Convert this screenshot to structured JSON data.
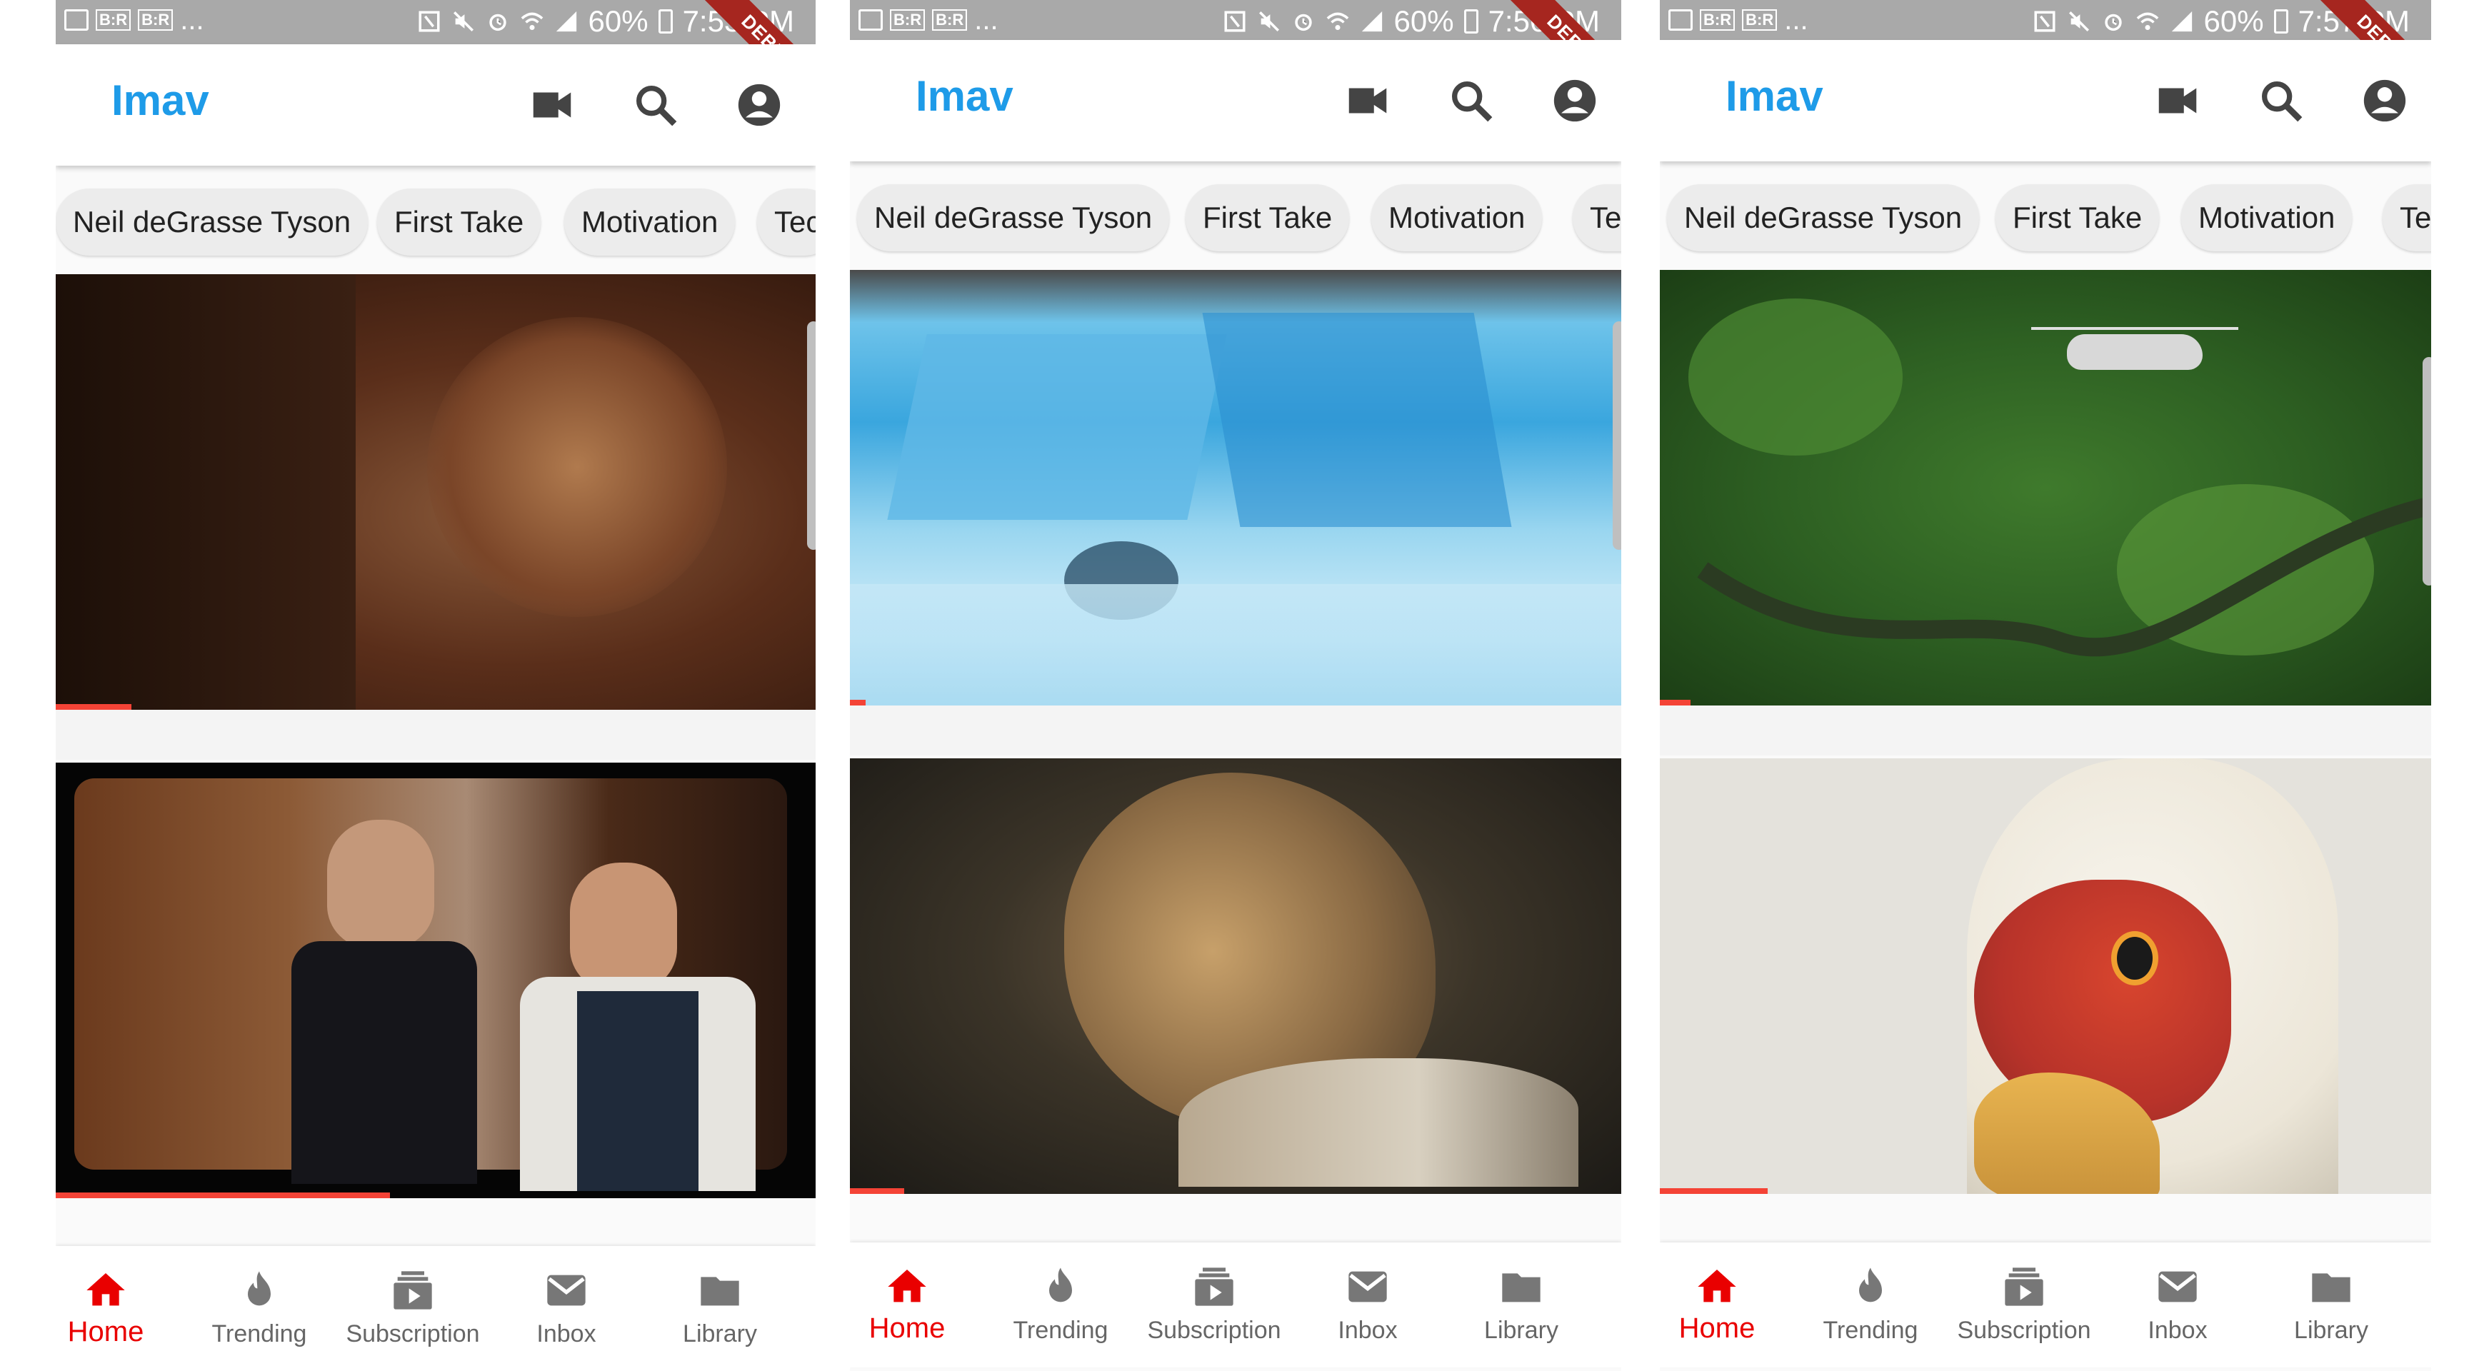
{
  "colors": {
    "status_bar": "#a9a9a9",
    "brand_blue": "#1e9be8",
    "active_red": "#e90000",
    "progress_red": "#f44336",
    "debug_ribbon": "#a6261f"
  },
  "screens": [
    {
      "status": {
        "battery": "60%",
        "time": "7:53 PM",
        "chip1": "B:R",
        "chip2": "B:R",
        "more": "..."
      },
      "debug_label": "DEBUG",
      "app_title": "Imav",
      "chips": [
        "Neil deGrasse Tyson",
        "First Take",
        "Motivation",
        "Tec"
      ],
      "videos": [
        {
          "scene": "close-up face, warm brown tones",
          "progress": 0.1
        },
        {
          "scene": "two men in suits, wedding",
          "progress": 0.44
        }
      ],
      "nav": [
        "Home",
        "Trending",
        "Subscription",
        "Inbox",
        "Library"
      ],
      "active_nav": "Home"
    },
    {
      "status": {
        "battery": "60%",
        "time": "7:56 PM",
        "chip1": "B:R",
        "chip2": "B:R",
        "more": "..."
      },
      "debug_label": "DEBUG",
      "app_title": "Imav",
      "chips": [
        "Neil deGrasse Tyson",
        "First Take",
        "Motivation",
        "Tec"
      ],
      "videos": [
        {
          "scene": "blue glacier ice",
          "progress": 0.02
        },
        {
          "scene": "leopard lying down",
          "progress": 0.07
        }
      ],
      "nav": [
        "Home",
        "Trending",
        "Subscription",
        "Inbox",
        "Library"
      ],
      "active_nav": "Home"
    },
    {
      "status": {
        "battery": "60%",
        "time": "7:57 PM",
        "chip1": "B:R",
        "chip2": "B:R",
        "more": "..."
      },
      "debug_label": "DEBUG",
      "app_title": "Imav",
      "chips": [
        "Neil deGrasse Tyson",
        "First Take",
        "Motivation",
        "Tec"
      ],
      "videos": [
        {
          "scene": "helicopter over rainforest",
          "progress": 0.04
        },
        {
          "scene": "vulture head close-up",
          "progress": 0.14
        }
      ],
      "nav": [
        "Home",
        "Trending",
        "Subscription",
        "Inbox",
        "Library"
      ],
      "active_nav": "Home"
    }
  ]
}
